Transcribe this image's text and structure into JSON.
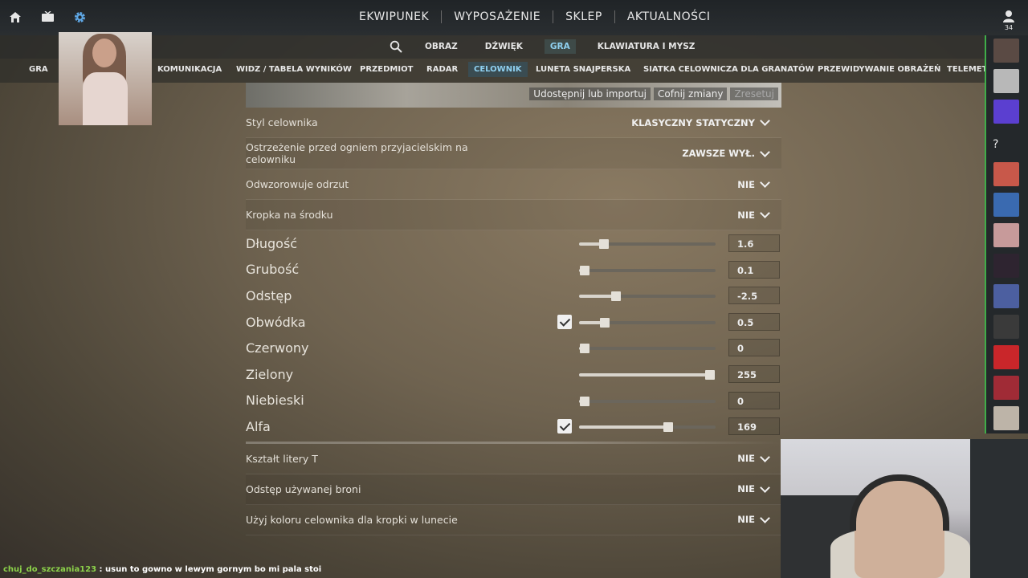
{
  "topbar": {
    "icons": [
      "home-icon",
      "tv-icon",
      "gear-icon"
    ],
    "nav": [
      "EKWIPUNEK",
      "WYPOSAŻENIE",
      "SKLEP",
      "AKTUALNOŚCI"
    ],
    "user_count": "34"
  },
  "subnav": {
    "items": [
      "OBRAZ",
      "DŹWIĘK",
      "GRA",
      "KLAWIATURA I MYSZ"
    ],
    "active": "GRA"
  },
  "categories": {
    "items": [
      "GRA",
      "KOMUNIKACJA",
      "WIDZ / TABELA WYNIKÓW",
      "PRZEDMIOT",
      "RADAR",
      "CELOWNIK",
      "LUNETA SNAJPERSKA",
      "SIATKA CELOWNICZA DLA GRANATÓW",
      "PRZEWIDYWANIE OBRAŻEŃ",
      "TELEMET"
    ],
    "active": "CELOWNIK"
  },
  "preview_actions": [
    "Udostępnij lub importuj",
    "Cofnij zmiany",
    "Zresetuj"
  ],
  "dropdown_rows": [
    {
      "label": "Styl celownika",
      "value": "KLASYCZNY STATYCZNY"
    },
    {
      "label": "Ostrzeżenie przed ogniem przyjacielskim na celowniku",
      "value": "ZAWSZE WYŁ."
    },
    {
      "label": "Odwzorowuje odrzut",
      "value": "NIE"
    },
    {
      "label": "Kropka na środku",
      "value": "NIE"
    }
  ],
  "slider_rows": [
    {
      "label": "Długość",
      "value": "1.6",
      "level": 0.18,
      "checkbox": false
    },
    {
      "label": "Grubość",
      "value": "0.1",
      "level": 0.04,
      "checkbox": false
    },
    {
      "label": "Odstęp",
      "value": "-2.5",
      "level": 0.27,
      "checkbox": false
    },
    {
      "label": "Obwódka",
      "value": "0.5",
      "level": 0.19,
      "checkbox": true
    },
    {
      "label": "Czerwony",
      "value": "0",
      "level": 0.04,
      "checkbox": false
    },
    {
      "label": "Zielony",
      "value": "255",
      "level": 0.96,
      "checkbox": false
    },
    {
      "label": "Niebieski",
      "value": "0",
      "level": 0.04,
      "checkbox": false
    },
    {
      "label": "Alfa",
      "value": "169",
      "level": 0.65,
      "checkbox": true
    }
  ],
  "bottom_rows": [
    {
      "label": "Kształt litery T",
      "value": "NIE"
    },
    {
      "label": "Odstęp używanej broni",
      "value": "NIE"
    },
    {
      "label": "Użyj koloru celownika dla kropki w lunecie",
      "value": "NIE"
    }
  ],
  "friends": {
    "help_label": "?",
    "avatar_colors": [
      "#5a4a44",
      "#b8b8b8",
      "#5b3fd0",
      "#c8584a",
      "#3a6ab0",
      "#c79a9a",
      "#2e2430",
      "#4c5fa0",
      "#3a3a3a",
      "#c9262a",
      "#a02b36",
      "#bdb4a8"
    ]
  },
  "chat": {
    "user": "chuj_do_szczania123",
    "message": " : usun to gowno w lewym gornym bo mi pala stoi"
  }
}
